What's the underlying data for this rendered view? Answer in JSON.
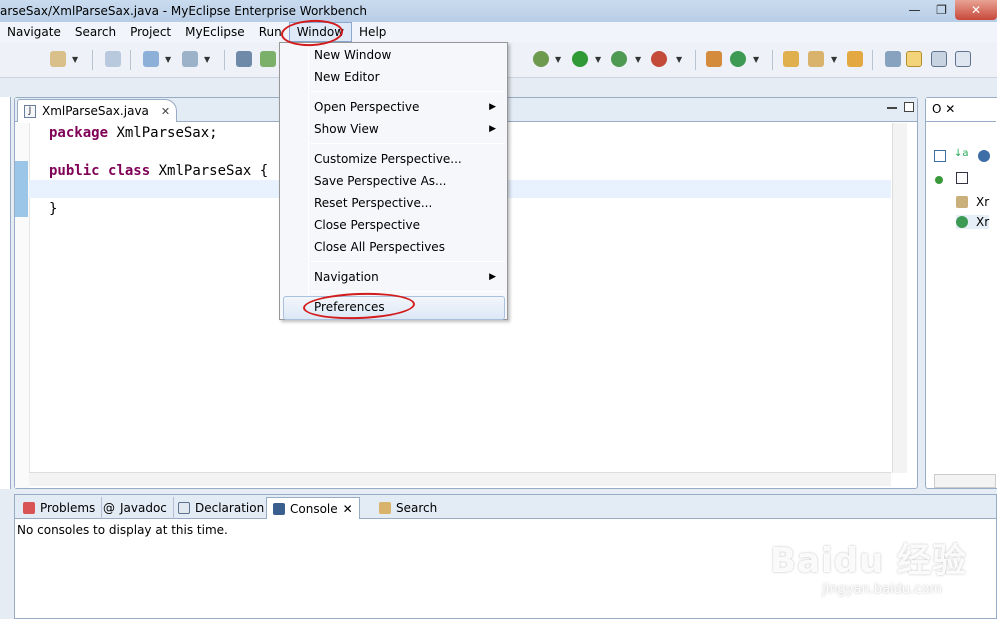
{
  "window": {
    "title": "arseSax/XmlParseSax.java - MyEclipse Enterprise Workbench",
    "min": "—",
    "max": "❐",
    "close": "✕"
  },
  "menubar": {
    "items": [
      "Navigate",
      "Search",
      "Project",
      "MyEclipse",
      "Run",
      "Window",
      "Help"
    ],
    "active": "Window"
  },
  "editor": {
    "tab_label": "XmlParseSax.java",
    "tab_icon_letter": "J",
    "code": {
      "line1_kw": "package",
      "line1_rest": " XmlParseSax;",
      "line2_kw1": "public",
      "line2_kw2": "class",
      "line2_rest": " XmlParseSax {",
      "line3": "}"
    }
  },
  "outline": {
    "tab_label": "O",
    "items": [
      "Xr",
      "Xr"
    ]
  },
  "window_menu": {
    "items": [
      {
        "label": "New Window"
      },
      {
        "label": "New Editor"
      },
      {
        "label": "Open Perspective",
        "submenu": true
      },
      {
        "label": "Show View",
        "submenu": true
      },
      {
        "label": "Customize Perspective..."
      },
      {
        "label": "Save Perspective As..."
      },
      {
        "label": "Reset Perspective..."
      },
      {
        "label": "Close Perspective"
      },
      {
        "label": "Close All Perspectives"
      },
      {
        "label": "Navigation",
        "submenu": true
      },
      {
        "label": "Preferences"
      }
    ],
    "highlighted": "Preferences",
    "submenu_arrow": "▶"
  },
  "bottom_panel": {
    "tabs": [
      "Problems",
      "Javadoc",
      "Declaration",
      "Console",
      "Search"
    ],
    "active": "Console",
    "message": "No consoles to display at this time."
  },
  "watermark": {
    "logo": "Baidu 经验",
    "url": "jingyan.baidu.com"
  },
  "colors": {
    "keyword": "#7f0055",
    "annotation": "#d21b1b",
    "menu_highlight": "#dde8f6"
  }
}
